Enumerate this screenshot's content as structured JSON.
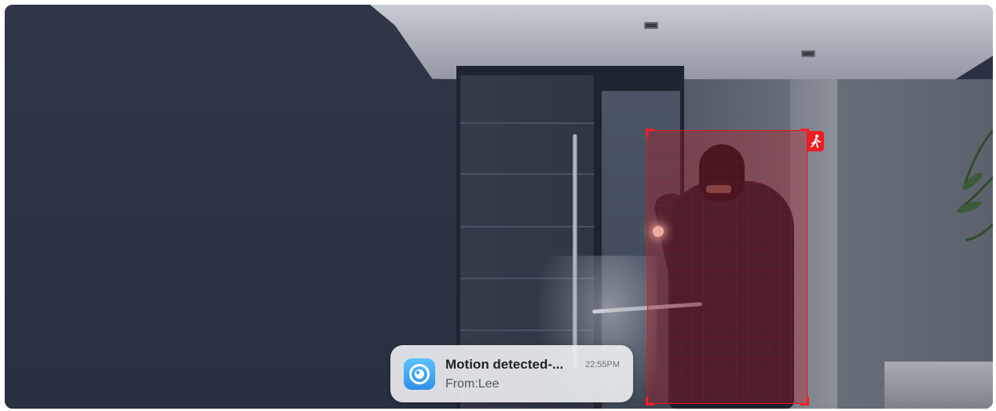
{
  "notification": {
    "title": "Motion detected-...",
    "from": "From:Lee",
    "time": "22:55PM",
    "app_icon": "camera-app-icon"
  },
  "detection": {
    "type_icon": "person-walking-icon",
    "box_color": "#e8121b"
  },
  "colors": {
    "notification_bg": "#e9ebef",
    "app_icon_blue": "#2f8fe8",
    "detect_red": "#ee1c25"
  }
}
